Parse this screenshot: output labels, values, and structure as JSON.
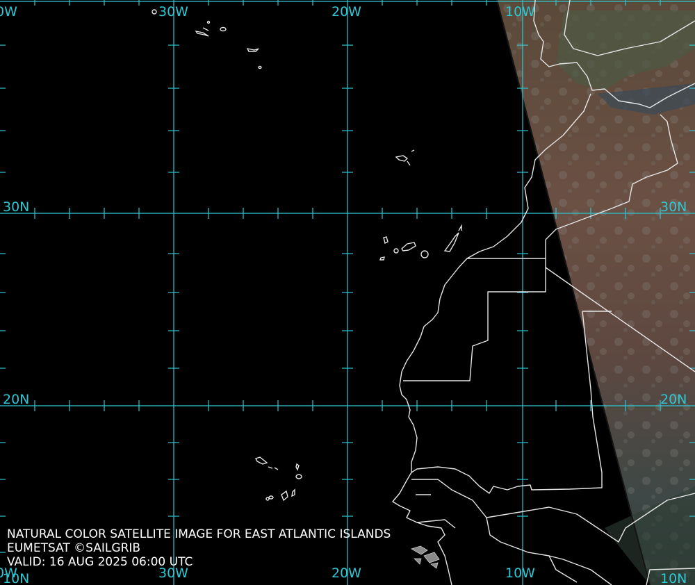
{
  "map": {
    "longitude_labels": [
      "0W",
      "30W",
      "20W",
      "10W"
    ],
    "bottom_longitude_labels": [
      "0W",
      "30W",
      "20W",
      "10W"
    ],
    "latitude_labels": {
      "lat30_left": "30N",
      "lat30_right": "30N",
      "lat20_left": "20N",
      "lat20_right": "20N",
      "lat10_left": "10N",
      "lat10_right": "10N"
    },
    "colors": {
      "ocean": "#000000",
      "grid": "#2ec8d4",
      "coastline": "#e6e6e6",
      "caption": "#ffffff"
    }
  },
  "caption": {
    "line1": "NATURAL COLOR SATELLITE IMAGE FOR EAST ATLANTIC ISLANDS",
    "line2": "EUMETSAT ©SAILGRIB",
    "line3": "VALID:  16 AUG 2025 06:00 UTC"
  }
}
